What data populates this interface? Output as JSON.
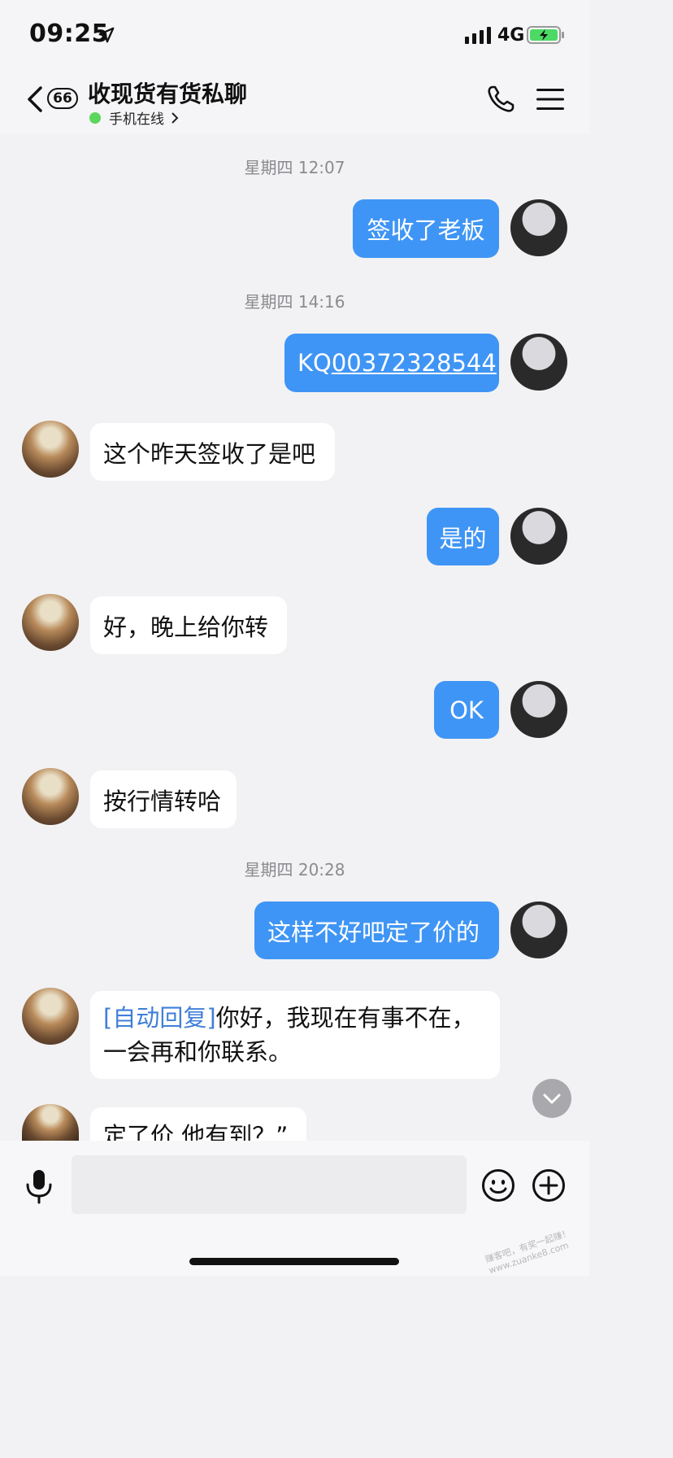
{
  "status_bar": {
    "time": "09:25",
    "network": "4G"
  },
  "header": {
    "back_count": "66",
    "title": "收现货有货私聊",
    "status": "手机在线"
  },
  "messages": [
    {
      "timestamp": "星期四 12:07"
    },
    {
      "text": "签收了老板"
    },
    {
      "timestamp": "星期四 14:16"
    },
    {
      "prefix": "KQ",
      "link": "00372328544"
    },
    {
      "text": "这个昨天签收了是吧"
    },
    {
      "text": "是的"
    },
    {
      "text": "好，晚上给你转"
    },
    {
      "text": "OK"
    },
    {
      "text": "按行情转哈"
    },
    {
      "timestamp": "星期四 20:28"
    },
    {
      "text": "这样不好吧定了价的"
    },
    {
      "tag": "[自动回复]",
      "text": "你好，我现在有事不在，一会再和你联系。"
    },
    {
      "text": "定了价 他有到？”"
    }
  ],
  "watermark": "赚客吧，有奖一起赚！www.zuanke8.com",
  "icons": {
    "location": "location-arrow-icon",
    "signal": "signal-bars-icon",
    "battery": "battery-charging-icon",
    "back": "chevron-left-icon",
    "phone": "phone-icon",
    "menu": "menu-icon",
    "scroll": "chevron-down-icon",
    "mic": "microphone-icon",
    "emoji": "emoji-icon",
    "plus": "plus-icon"
  },
  "colors": {
    "bubble_mine": "#3f95f5",
    "bubble_other": "#ffffff",
    "online": "#5cd65c",
    "auto_reply_tag": "#3f7fd8"
  }
}
